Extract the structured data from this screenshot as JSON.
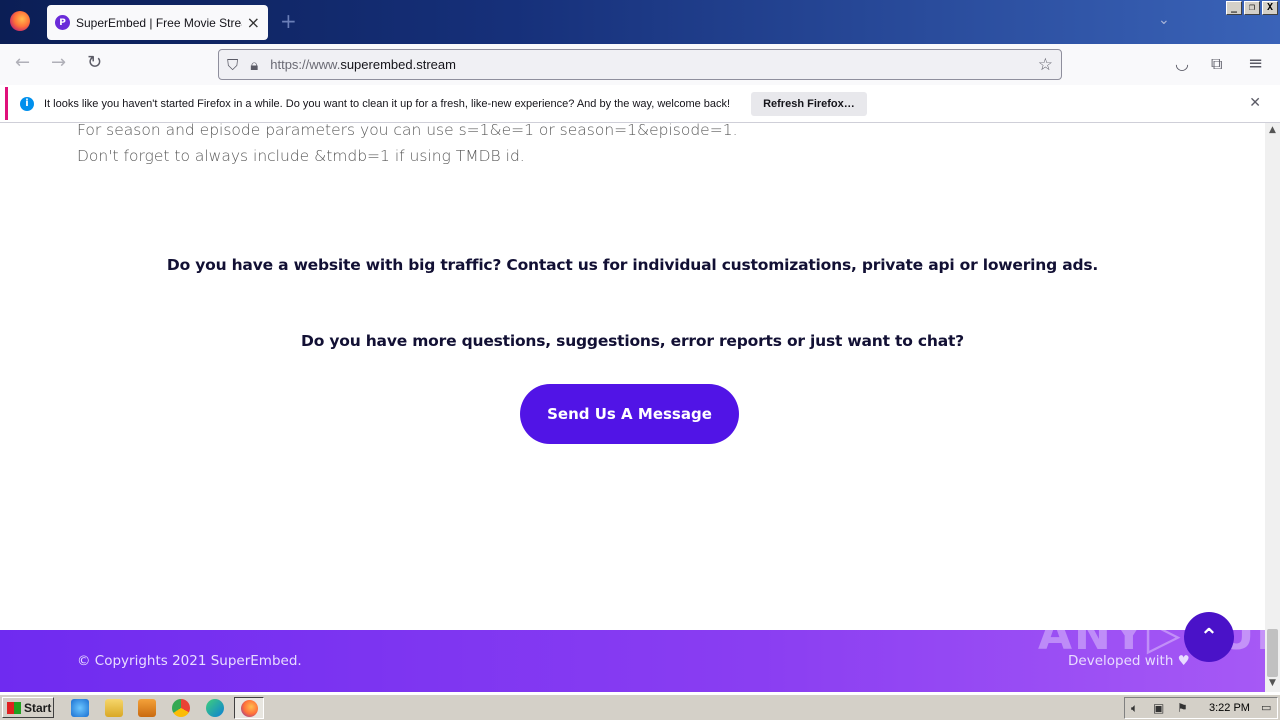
{
  "browser": {
    "tab_title": "SuperEmbed | Free Movie Streaming",
    "tab_favicon": "P",
    "new_tab_glyph": "+",
    "url_prefix": "https://www.",
    "url_domain": "superembed.stream",
    "window_buttons": [
      "_",
      "❐",
      "X"
    ]
  },
  "notification": {
    "text": "It looks like you haven't started Firefox in a while. Do you want to clean it up for a fresh, like-new experience? And by the way, welcome back!",
    "button_label": "Refresh Firefox…"
  },
  "page": {
    "line1": "For season and episode parameters you can use s=1&e=1 or season=1&episode=1.",
    "line2": "Don't forget to always include &tmdb=1 if using TMDB id.",
    "question1": "Do you have a website with big traffic? Contact us for individual customizations, private api or lowering ads.",
    "question2": "Do you have more questions, suggestions, error reports or just want to chat?",
    "send_button": "Send Us A Message",
    "footer_copyright": "© Copyrights 2021 SuperEmbed.",
    "footer_developed": "Developed with ♥",
    "watermark": "ANY▷RUN"
  },
  "taskbar": {
    "start_label": "Start",
    "clock": "3:22 PM"
  },
  "colors": {
    "accent_button": "#5114e6",
    "footer_gradient_start": "#6f2bf0",
    "notification_border": "#e0107b"
  }
}
